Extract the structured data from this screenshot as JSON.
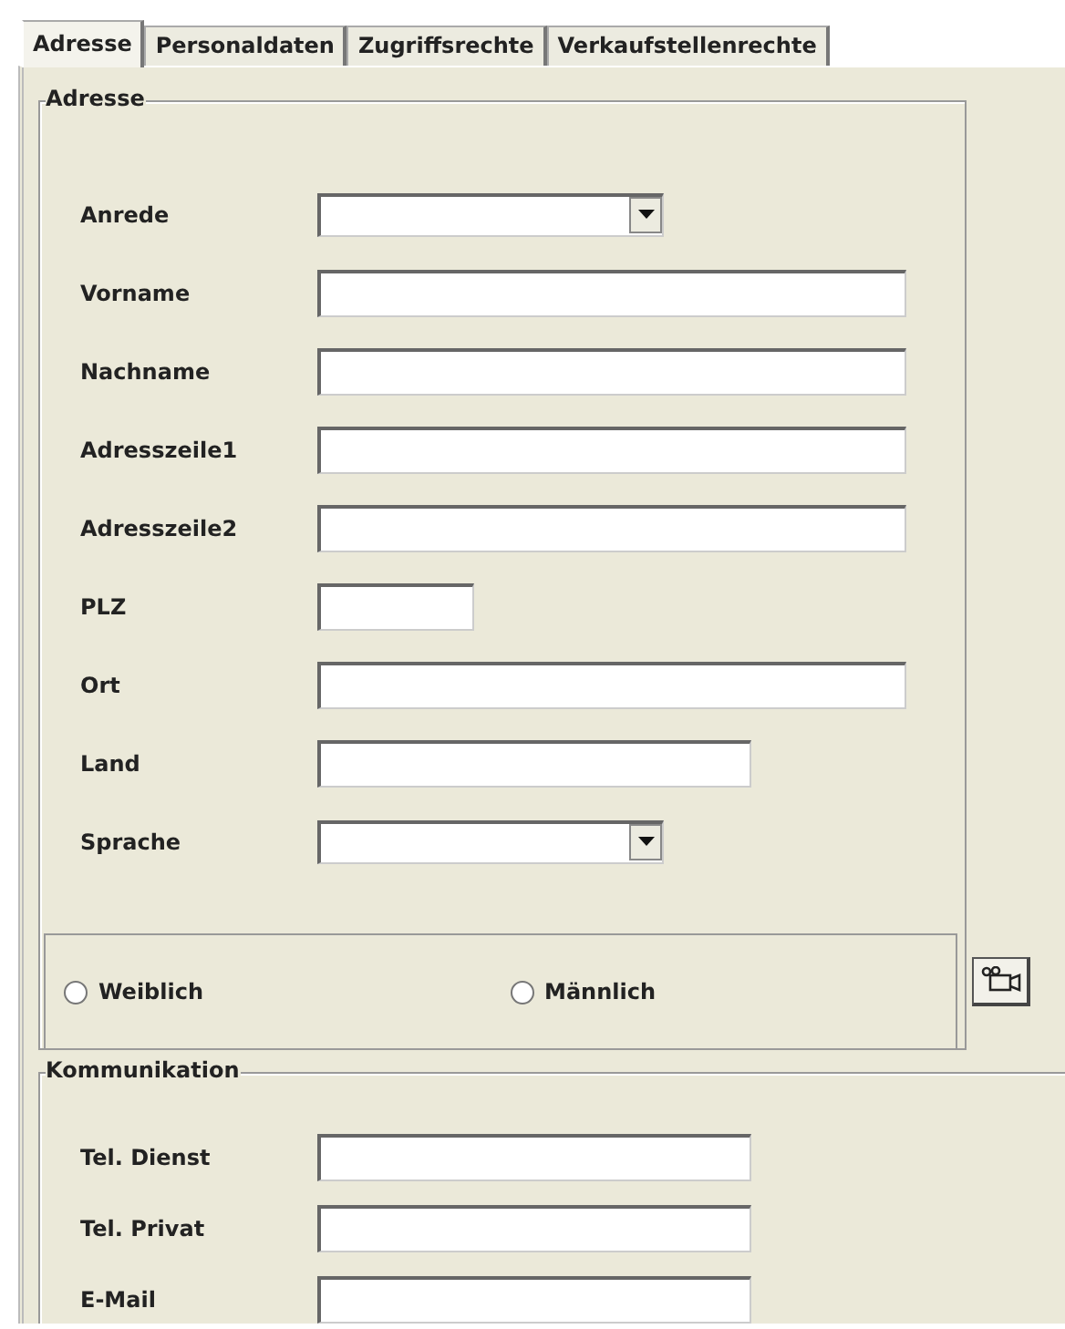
{
  "tabs": [
    {
      "label": "Adresse",
      "selected": true
    },
    {
      "label": "Personaldaten",
      "selected": false
    },
    {
      "label": "Zugriffsrechte",
      "selected": false
    },
    {
      "label": "Verkaufstellenrechte",
      "selected": false
    }
  ],
  "address": {
    "title": "Adresse",
    "fields": [
      {
        "label": "Anrede",
        "kind": "dropdown"
      },
      {
        "label": "Vorname",
        "kind": "long"
      },
      {
        "label": "Nachname",
        "kind": "long"
      },
      {
        "label": "Adresszeile1",
        "kind": "long"
      },
      {
        "label": "Adresszeile2",
        "kind": "long"
      },
      {
        "label": "PLZ",
        "kind": "short"
      },
      {
        "label": "Ort",
        "kind": "long"
      },
      {
        "label": "Land",
        "kind": "medium"
      },
      {
        "label": "Sprache",
        "kind": "dropdown"
      }
    ],
    "gender": [
      {
        "label": "Weiblich",
        "selected": false
      },
      {
        "label": "Männlich",
        "selected": false
      }
    ]
  },
  "communication": {
    "title": "Kommunikation",
    "fields": [
      {
        "label": "Tel. Dienst",
        "kind": "medium"
      },
      {
        "label": "Tel. Privat",
        "kind": "medium"
      },
      {
        "label": "E-Mail",
        "kind": "medium"
      }
    ]
  }
}
